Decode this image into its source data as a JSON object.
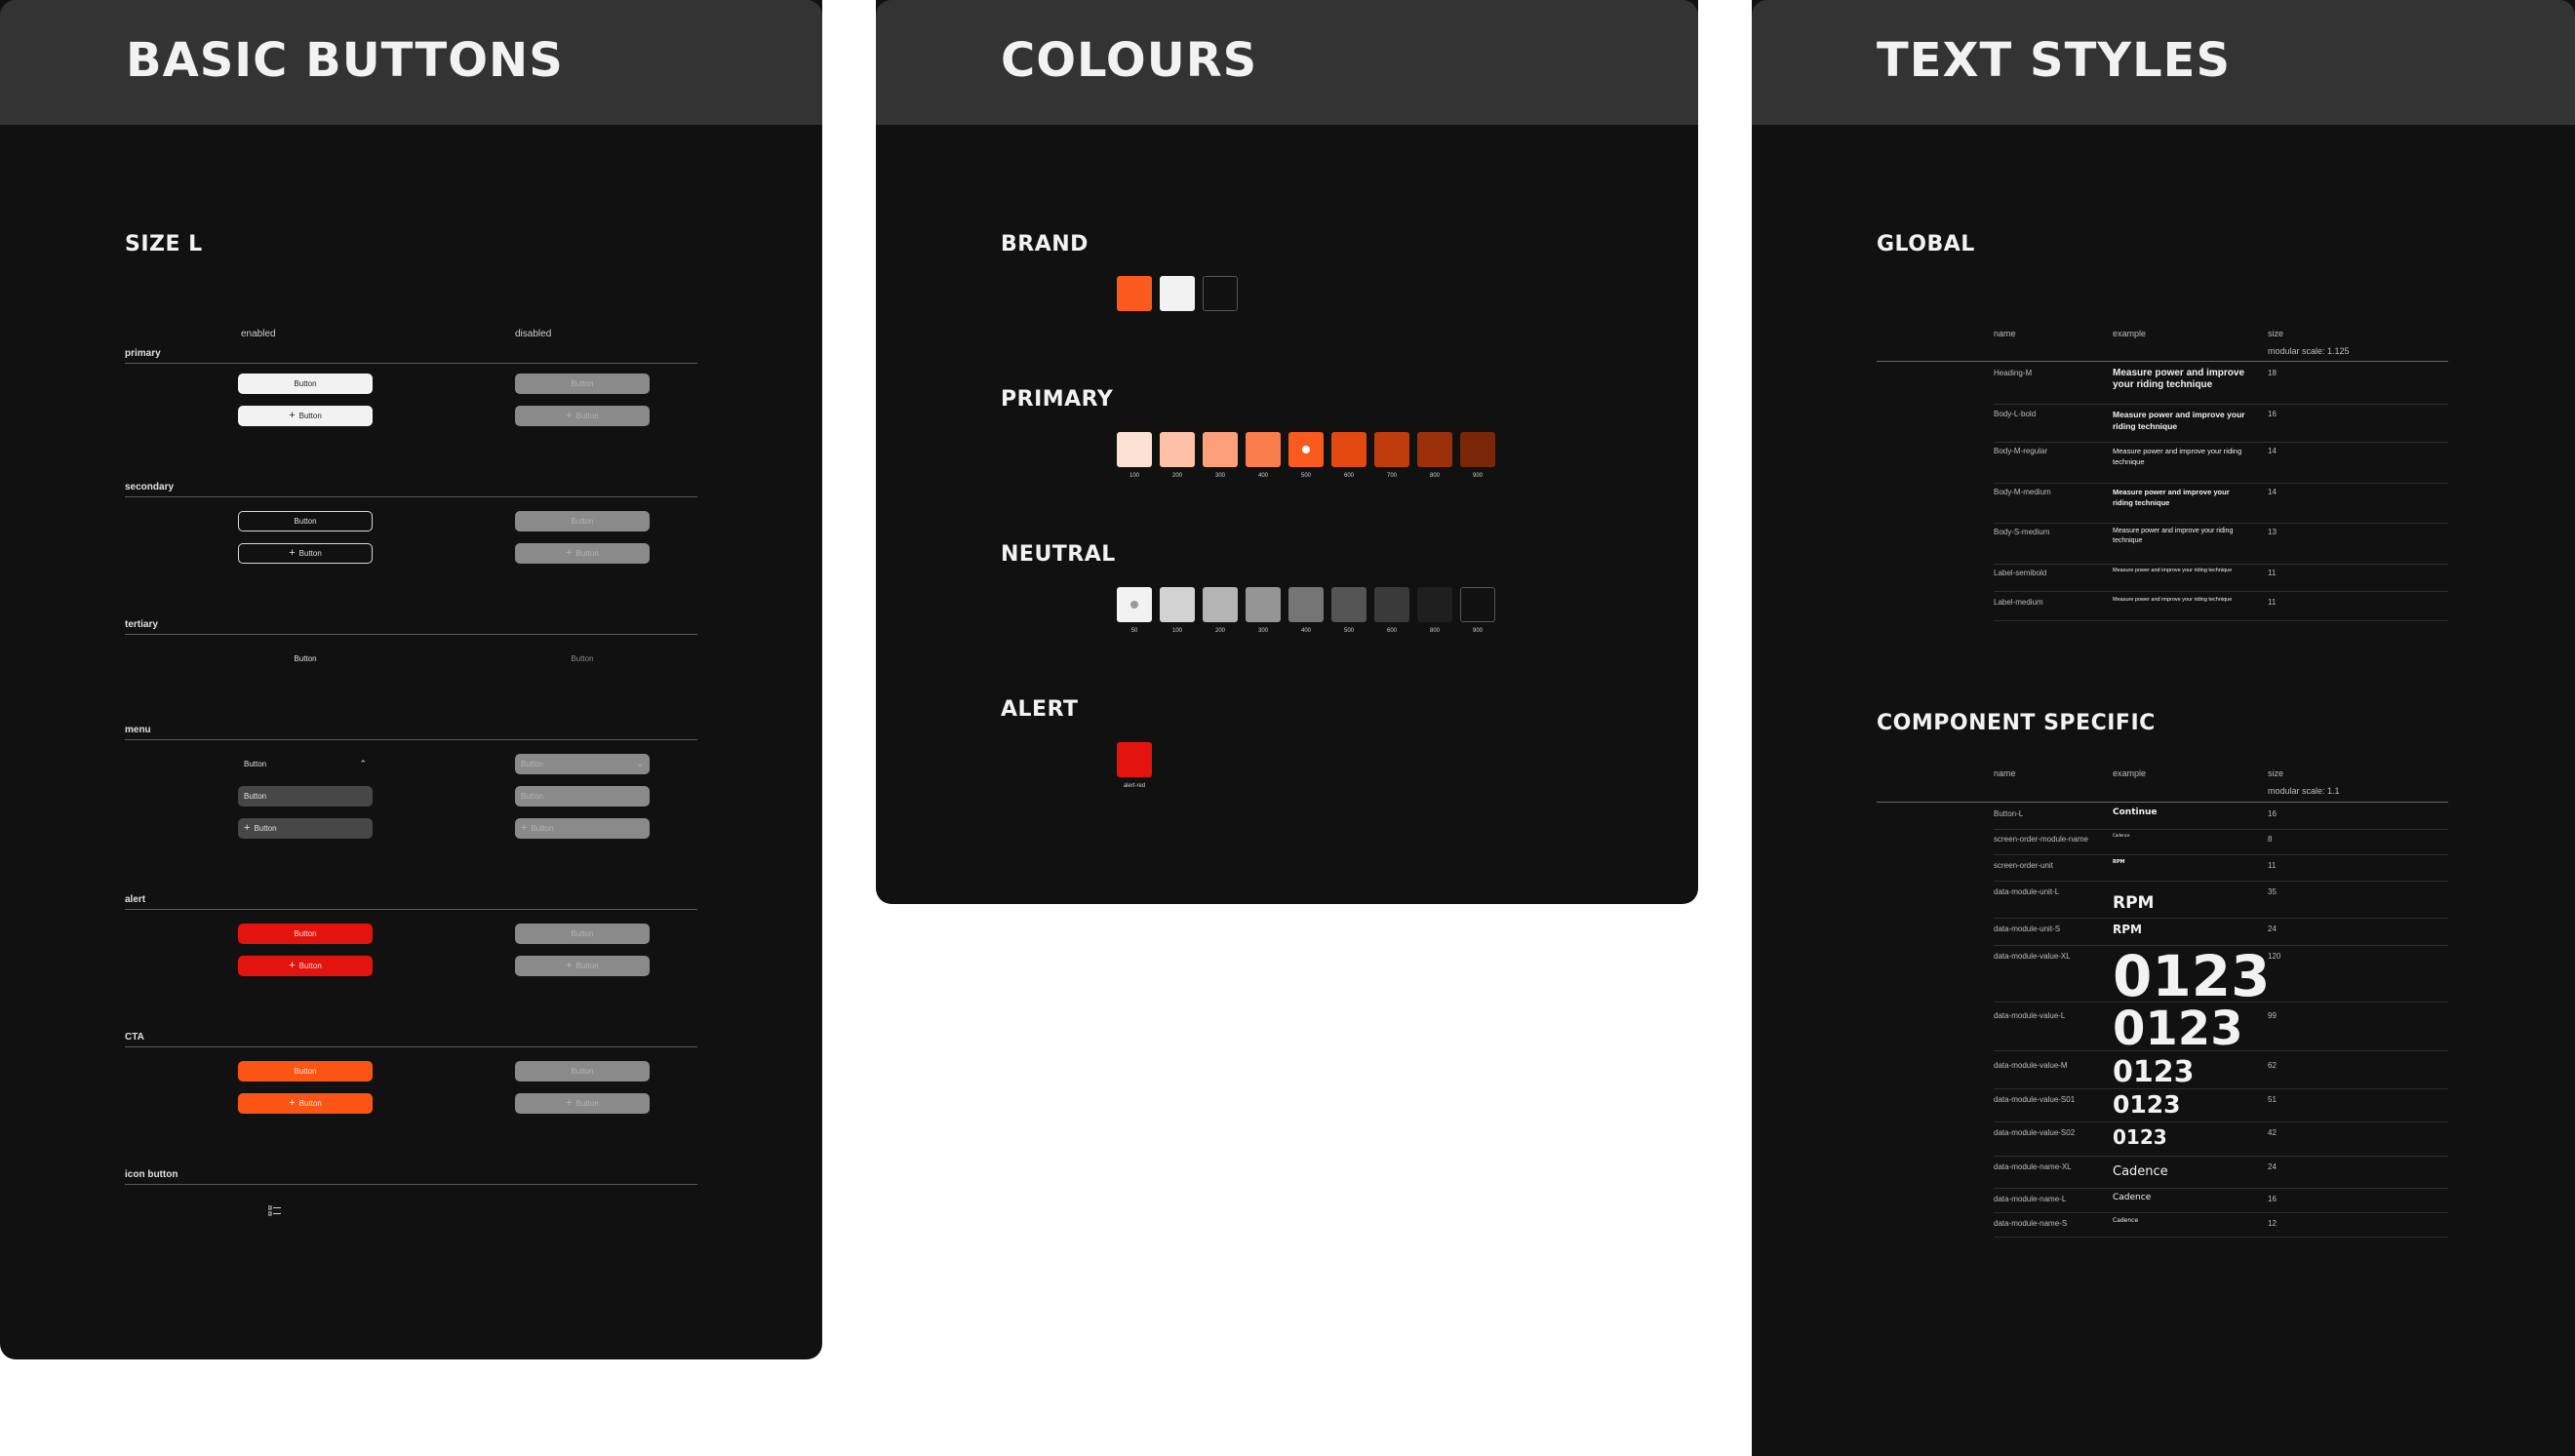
{
  "panels": {
    "buttons": {
      "title": "BASIC BUTTONS",
      "size_title": "SIZE L",
      "col_enabled": "enabled",
      "col_disabled": "disabled",
      "groups": {
        "primary": "primary",
        "secondary": "secondary",
        "tertiary": "tertiary",
        "menu": "menu",
        "alert": "alert",
        "cta": "CTA",
        "icon_button": "icon button"
      },
      "button_label": "Button",
      "icon": "list-icon"
    },
    "colours": {
      "title": "COLOURS",
      "brand": {
        "title": "BRAND",
        "swatches": [
          {
            "color": "#fa5a1e"
          },
          {
            "color": "#f2f2f2"
          },
          {
            "color": "#111111"
          }
        ]
      },
      "primary": {
        "title": "PRIMARY",
        "swatches": [
          {
            "label": "100",
            "color": "#fde0d4"
          },
          {
            "label": "200",
            "color": "#fcc1a6"
          },
          {
            "label": "300",
            "color": "#fba07a"
          },
          {
            "label": "400",
            "color": "#fa7d4d"
          },
          {
            "label": "500",
            "color": "#fa5a1e"
          },
          {
            "label": "600",
            "color": "#e44a10"
          },
          {
            "label": "700",
            "color": "#c03c0c"
          },
          {
            "label": "800",
            "color": "#9c300a"
          },
          {
            "label": "900",
            "color": "#7a2608"
          }
        ]
      },
      "neutral": {
        "title": "NEUTRAL",
        "swatches": [
          {
            "label": "50",
            "color": "#f2f2f2"
          },
          {
            "label": "100",
            "color": "#d2d2d2"
          },
          {
            "label": "200",
            "color": "#b4b4b4"
          },
          {
            "label": "300",
            "color": "#959595"
          },
          {
            "label": "400",
            "color": "#757575"
          },
          {
            "label": "500",
            "color": "#555555"
          },
          {
            "label": "600",
            "color": "#3a3a3a"
          },
          {
            "label": "800",
            "color": "#1f1f1f"
          },
          {
            "label": "900",
            "color": "#111111"
          }
        ]
      },
      "alert": {
        "title": "ALERT",
        "swatches": [
          {
            "label": "alert-red",
            "color": "#e3140d"
          }
        ]
      }
    },
    "text_styles": {
      "title": "TEXT STYLES",
      "global": {
        "title": "GLOBAL",
        "col_name": "name",
        "col_example": "example",
        "col_size": "size",
        "scale": "modular scale: 1.125",
        "rows": [
          {
            "name": "Heading-M",
            "example": "Measure power and improve your riding technique",
            "size": "18"
          },
          {
            "name": "Body-L-bold",
            "example": "Measure power and improve your riding technique",
            "size": "16"
          },
          {
            "name": "Body-M-regular",
            "example": "Measure power and improve your riding technique",
            "size": "14"
          },
          {
            "name": "Body-M-medium",
            "example": "Measure power and improve your riding technique",
            "size": "14"
          },
          {
            "name": "Body-S-medium",
            "example": "Measure power and improve your riding technique",
            "size": "13"
          },
          {
            "name": "Label-semibold",
            "example": "Measure power and improve your riding technique",
            "size": "11"
          },
          {
            "name": "Label-medium",
            "example": "Measure power and improve your riding technique",
            "size": "11"
          }
        ]
      },
      "component": {
        "title": "COMPONENT SPECIFIC",
        "col_name": "name",
        "col_example": "example",
        "col_size": "size",
        "scale": "modular scale: 1.1",
        "rows": [
          {
            "name": "Button-L",
            "example": "Continue",
            "size": "16"
          },
          {
            "name": "screen-order-module-name",
            "example": "Cadence",
            "size": "8"
          },
          {
            "name": "screen-order-unit",
            "example": "RPM",
            "size": "11"
          },
          {
            "name": "data-module-unit-L",
            "example": "RPM",
            "size": "35"
          },
          {
            "name": "data-module-unit-S",
            "example": "RPM",
            "size": "24"
          },
          {
            "name": "data-module-value-XL",
            "example": "0123",
            "size": "120"
          },
          {
            "name": "data-module-value-L",
            "example": "0123",
            "size": "99"
          },
          {
            "name": "data-module-value-M",
            "example": "0123",
            "size": "62"
          },
          {
            "name": "data-module-value-S01",
            "example": "0123",
            "size": "51"
          },
          {
            "name": "data-module-value-S02",
            "example": "0123",
            "size": "42"
          },
          {
            "name": "data-module-name-XL",
            "example": "Cadence",
            "size": "24"
          },
          {
            "name": "data-module-name-L",
            "example": "Cadence",
            "size": "16"
          },
          {
            "name": "data-module-name-S",
            "example": "Cadence",
            "size": "12"
          }
        ]
      }
    }
  }
}
